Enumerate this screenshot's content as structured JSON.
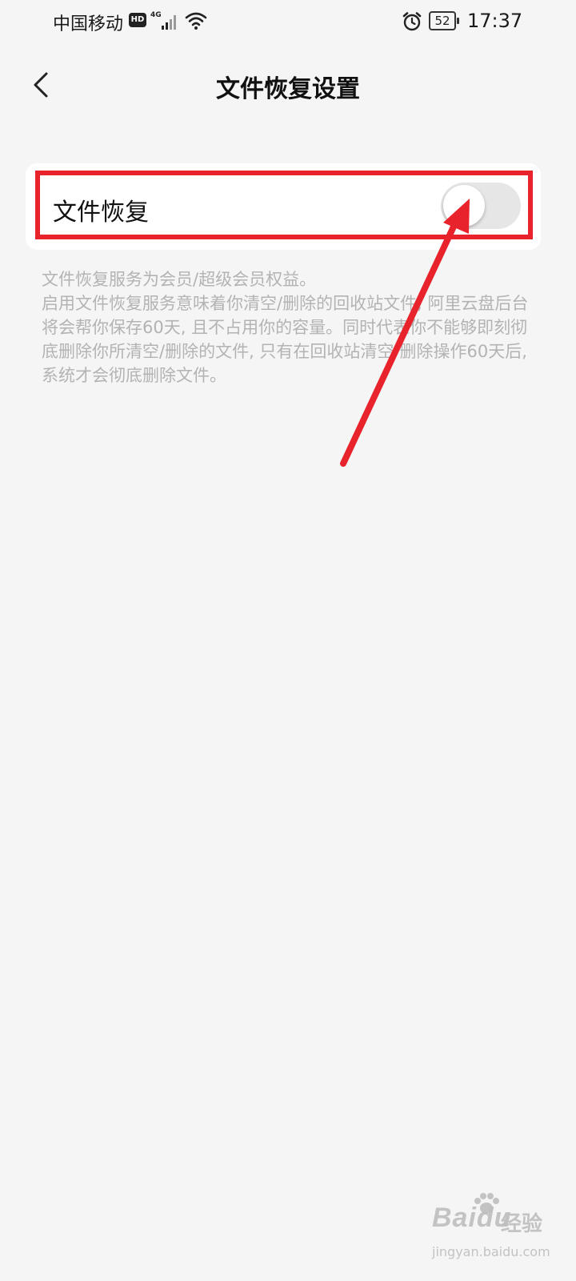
{
  "status_bar": {
    "carrier": "中国移动",
    "hd": "HD",
    "network": "4G",
    "battery": "52",
    "time": "17:37",
    "icons": [
      "signal-icon",
      "wifi-icon",
      "alarm-icon",
      "battery-icon"
    ]
  },
  "nav": {
    "back_icon": "chevron-left-icon",
    "title": "文件恢复设置"
  },
  "setting": {
    "label": "文件恢复",
    "toggle_on": false
  },
  "description": {
    "line1": "文件恢复服务为会员/超级会员权益。",
    "line2": "启用文件恢复服务意味着你清空/删除的回收站文件, 阿里云盘后台将会帮你保存60天, 且不占用你的容量。同时代表你不能够即刻彻底删除你所清空/删除的文件, 只有在回收站清空/删除操作60天后, 系统才会彻底删除文件。"
  },
  "annotation": {
    "color": "#e8232b"
  },
  "watermark": {
    "logo": "Baidu",
    "text": "经验",
    "url": "jingyan.baidu.com"
  }
}
